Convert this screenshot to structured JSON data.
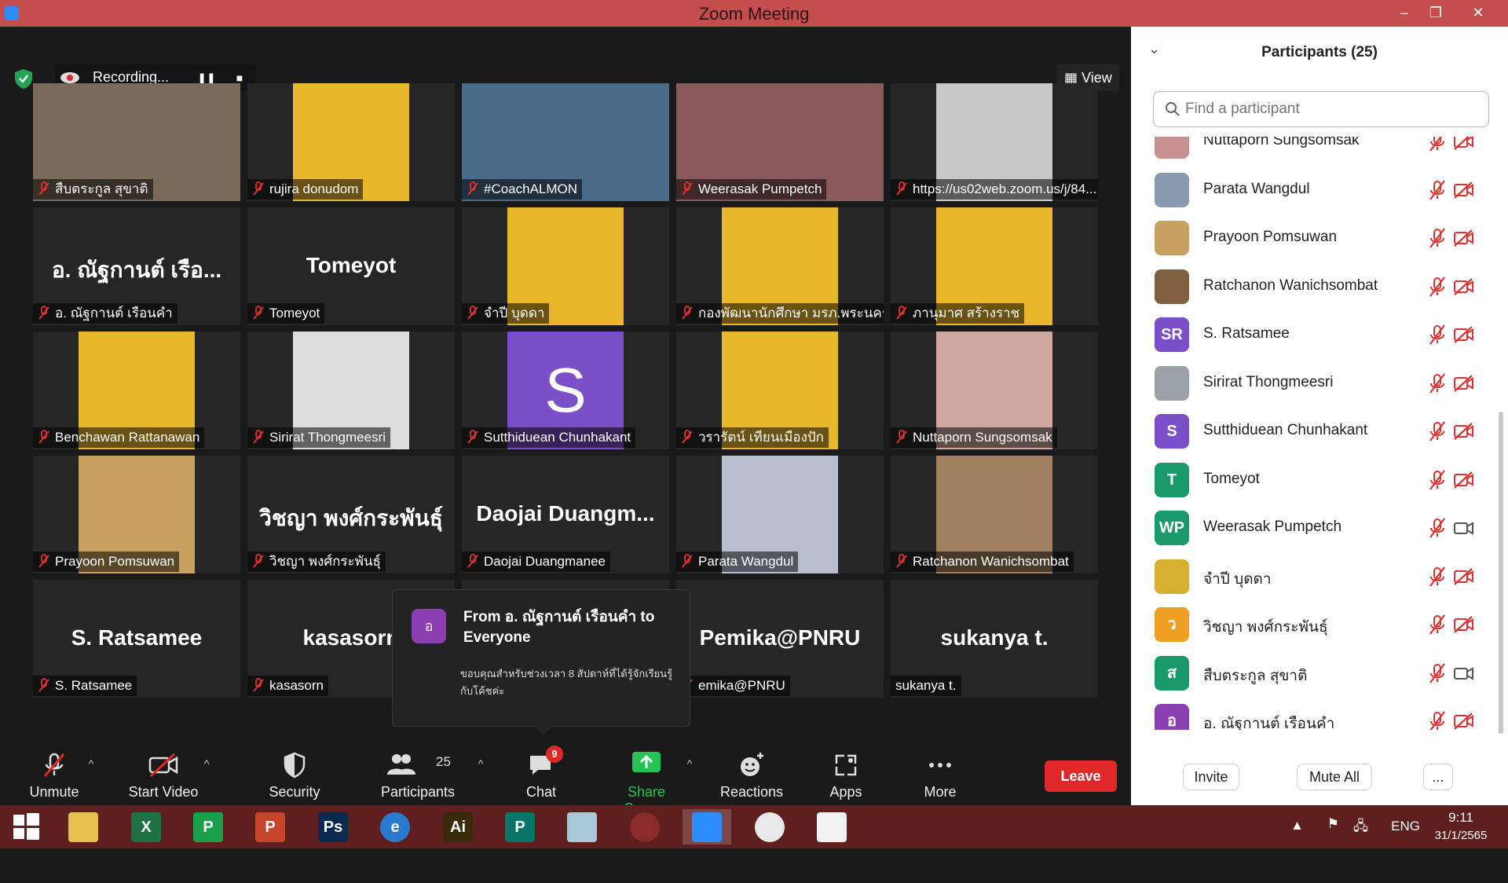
{
  "window": {
    "title": "Zoom Meeting",
    "minimize": "–",
    "restore": "❐",
    "close": "✕"
  },
  "recording": {
    "label": "Recording...",
    "pause": "❚❚",
    "stop": "■"
  },
  "view_button": "View",
  "tiles": [
    {
      "label": "สืบตระกูล สุขาติ",
      "photo": "#7a6a5a",
      "big": ""
    },
    {
      "label": "rujira donudom",
      "photo": "#e8b62a",
      "big": ""
    },
    {
      "label": "#CoachALMON",
      "photo": "#4a6a8a",
      "big": "",
      "active": true
    },
    {
      "label": "Weerasak Pumpetch",
      "photo": "#8a5a5a",
      "big": ""
    },
    {
      "label": "https://us02web.zoom.us/j/84...",
      "photo": "#c8c8c8",
      "big": ""
    },
    {
      "label": "อ. ณัฐกานต์ เรือนคำ",
      "photo": "",
      "big": "อ. ณัฐกานต์  เรือ..."
    },
    {
      "label": "Tomeyot",
      "photo": "",
      "big": "Tomeyot"
    },
    {
      "label": "จำปี บุดดา",
      "photo": "#e8b62a",
      "big": ""
    },
    {
      "label": "กองพัฒนานักศึกษา มรภ.พระนคร",
      "photo": "#e8b62a",
      "big": ""
    },
    {
      "label": "ภานุมาศ สร้างราช",
      "photo": "#e8b62a",
      "big": ""
    },
    {
      "label": "Benchawan Rattanawan",
      "photo": "#e8b62a",
      "big": ""
    },
    {
      "label": "Sirirat Thongmeesri",
      "photo": "#dcdcdc",
      "big": ""
    },
    {
      "label": "Sutthiduean Chunhakant",
      "photo": "#7b4fc8",
      "big": "",
      "letter": "S"
    },
    {
      "label": "วรารัตน์ เทียนเมืองปัก",
      "photo": "#e8b62a",
      "big": ""
    },
    {
      "label": "Nuttaporn Sungsomsak",
      "photo": "#d0a8a0",
      "big": ""
    },
    {
      "label": "Prayoon Pomsuwan",
      "photo": "#c8a060",
      "big": ""
    },
    {
      "label": "วิชญา พงศ์กระพันธุ์",
      "photo": "",
      "big": "วิชญา พงศ์กระพันธุ์"
    },
    {
      "label": "Daojai Duangmanee",
      "photo": "",
      "big": "Daojai  Duangm..."
    },
    {
      "label": "Parata Wangdul",
      "photo": "#b8c0d0",
      "big": ""
    },
    {
      "label": "Ratchanon Wanichsombat",
      "photo": "#a08060",
      "big": ""
    },
    {
      "label": "S. Ratsamee",
      "photo": "",
      "big": "S. Ratsamee"
    },
    {
      "label": "kasasorn",
      "photo": "",
      "big": "kasasorn"
    },
    {
      "label": "",
      "photo": "",
      "big": ""
    },
    {
      "label": "emika@PNRU",
      "photo": "",
      "big": "Pemika@PNRU"
    },
    {
      "label": "sukanya t.",
      "photo": "",
      "big": "sukanya t.",
      "nomic": true
    }
  ],
  "chat_popup": {
    "avatar": "อ",
    "from": "From อ. ณัฐกานต์  เรือนคำ to Everyone",
    "message": "ขอบคุณสำหรับช่วงเวลา 8 สัปดาห์ที่ได้รู้จักเรียนรู้กับโค้ชค่ะ"
  },
  "toolbar": {
    "unmute": "Unmute",
    "start_video": "Start Video",
    "security": "Security",
    "participants": "Participants",
    "participants_count": "25",
    "chat": "Chat",
    "chat_badge": "9",
    "share_screen": "Share Screen",
    "reactions": "Reactions",
    "apps": "Apps",
    "more": "More",
    "leave": "Leave"
  },
  "panel": {
    "title": "Participants (25)",
    "search_placeholder": "Find a participant",
    "invite": "Invite",
    "mute_all": "Mute All",
    "more": "...",
    "participants": [
      {
        "name": "Nuttaporn Sungsomsak",
        "avatar": "",
        "color": "#c89090",
        "video": false
      },
      {
        "name": "Parata Wangdul",
        "avatar": "",
        "color": "#8a9ab0",
        "video": false
      },
      {
        "name": "Prayoon Pomsuwan",
        "avatar": "",
        "color": "#c8a060",
        "video": false
      },
      {
        "name": "Ratchanon Wanichsombat",
        "avatar": "",
        "color": "#806040",
        "video": false
      },
      {
        "name": "S. Ratsamee",
        "avatar": "SR",
        "color": "#7b4fc8",
        "video": false
      },
      {
        "name": "Sirirat Thongmeesri",
        "avatar": "",
        "color": "#9aa0a8",
        "video": false
      },
      {
        "name": "Sutthiduean Chunhakant",
        "avatar": "S",
        "color": "#7b4fc8",
        "video": false
      },
      {
        "name": "Tomeyot",
        "avatar": "T",
        "color": "#1a9a6a",
        "video": false
      },
      {
        "name": "Weerasak Pumpetch",
        "avatar": "WP",
        "color": "#1a9a6a",
        "video": true
      },
      {
        "name": "จำปี บุดดา",
        "avatar": "",
        "color": "#d8b030",
        "video": false
      },
      {
        "name": "วิชญา พงศ์กระพันธุ์",
        "avatar": "ว",
        "color": "#f0a020",
        "video": false
      },
      {
        "name": "สืบตระกูล สุขาติ",
        "avatar": "ส",
        "color": "#1a9a6a",
        "video": true
      },
      {
        "name": "อ. ณัฐกานต์  เรือนคำ",
        "avatar": "อ",
        "color": "#8b3fb0",
        "video": false
      }
    ]
  },
  "taskbar": {
    "apps": [
      {
        "name": "windows",
        "label": "",
        "color": "#ffffff"
      },
      {
        "name": "explorer",
        "label": "",
        "color": "#e8c050"
      },
      {
        "name": "excel",
        "label": "X",
        "color": "#1d7145"
      },
      {
        "name": "publisher-green",
        "label": "P",
        "color": "#1aa04a"
      },
      {
        "name": "powerpoint",
        "label": "P",
        "color": "#c8442a"
      },
      {
        "name": "photoshop",
        "label": "Ps",
        "color": "#0a2a50"
      },
      {
        "name": "edge",
        "label": "e",
        "color": "#2a7ad0"
      },
      {
        "name": "illustrator",
        "label": "Ai",
        "color": "#3a2a0a"
      },
      {
        "name": "publisher",
        "label": "P",
        "color": "#077568"
      },
      {
        "name": "notes",
        "label": "",
        "color": "#a8c8d8"
      },
      {
        "name": "photoscape",
        "label": "",
        "color": "#8a2a2a"
      },
      {
        "name": "zoom",
        "label": "",
        "color": "#2d8cff"
      },
      {
        "name": "chrome",
        "label": "",
        "color": "#e8e8e8"
      },
      {
        "name": "paint",
        "label": "",
        "color": "#f0f0f0"
      }
    ],
    "language": "ENG",
    "time": "9:11",
    "date": "31/1/2565"
  }
}
